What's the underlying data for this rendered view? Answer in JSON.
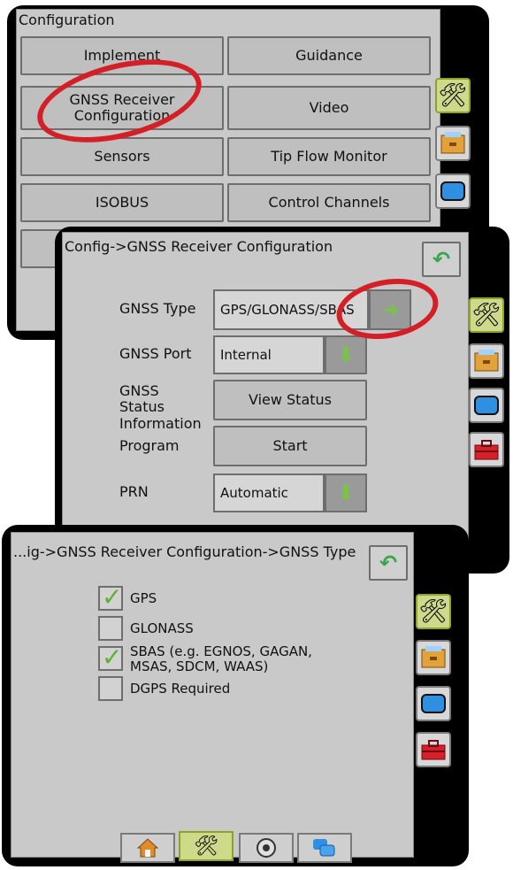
{
  "screen1": {
    "title": "Configuration",
    "buttons": [
      "Implement",
      "Guidance",
      "GNSS Receiver Configuration",
      "Video",
      "Sensors",
      "Tip Flow Monitor",
      "ISOBUS",
      "Control Channels"
    ]
  },
  "screen2": {
    "title": "Config->GNSS Receiver Configuration",
    "rows": {
      "gnss_type_label": "GNSS Type",
      "gnss_type_value": "GPS/GLONASS/SBAS",
      "gnss_port_label": "GNSS Port",
      "gnss_port_value": "Internal",
      "gnss_status_label": "GNSS Status Information",
      "gnss_status_button": "View Status",
      "program_label": "Program",
      "program_button": "Start",
      "prn_label": "PRN",
      "prn_value": "Automatic"
    }
  },
  "screen3": {
    "title": "...ig->GNSS Receiver Configuration->GNSS Type",
    "options": [
      {
        "label": "GPS",
        "checked": true
      },
      {
        "label": "GLONASS",
        "checked": false
      },
      {
        "label": "SBAS (e.g. EGNOS, GAGAN, MSAS, SDCM, WAAS)",
        "checked": true
      },
      {
        "label": "DGPS Required",
        "checked": false
      }
    ]
  },
  "icons": [
    "tools-icon",
    "storage-icon",
    "display-icon",
    "toolbox-icon",
    "back-arrow-icon",
    "home-icon",
    "gauge-icon",
    "windows-icon"
  ],
  "colors": {
    "highlight_ring": "#d51f26",
    "active_tab": "#cfd98a",
    "arrow_green": "#7cc24a"
  }
}
